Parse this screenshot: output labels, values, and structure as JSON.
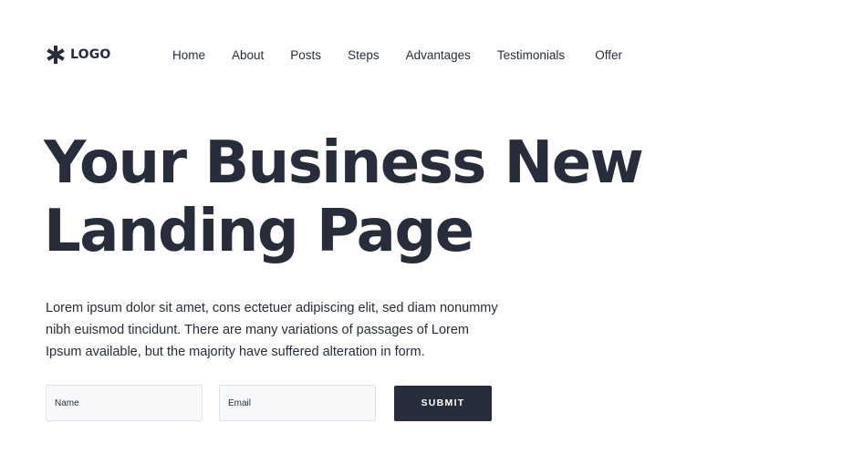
{
  "header": {
    "logo": {
      "icon": "asterisk-icon",
      "text": "LOGO"
    },
    "nav": [
      {
        "label": "Home"
      },
      {
        "label": "About"
      },
      {
        "label": "Posts"
      },
      {
        "label": "Steps"
      },
      {
        "label": "Advantages"
      },
      {
        "label": "Testimonials"
      },
      {
        "label": "Offer"
      }
    ]
  },
  "hero": {
    "title_line1": "Your Business New",
    "title_line2": "Landing Page",
    "description": "Lorem ipsum dolor sit amet, cons ectetuer adipiscing elit, sed diam nonummy nibh euismod tincidunt. There are many variations of passages of Lorem Ipsum available, but the majority have suffered alteration in form."
  },
  "form": {
    "name_placeholder": "Name",
    "name_value": "",
    "email_placeholder": "Email",
    "email_value": "",
    "submit_label": "SUBMIT"
  },
  "colors": {
    "primary": "#272d3b",
    "background": "#ffffff",
    "input_background": "#f7f8fa",
    "input_border": "#dfe2e8"
  }
}
